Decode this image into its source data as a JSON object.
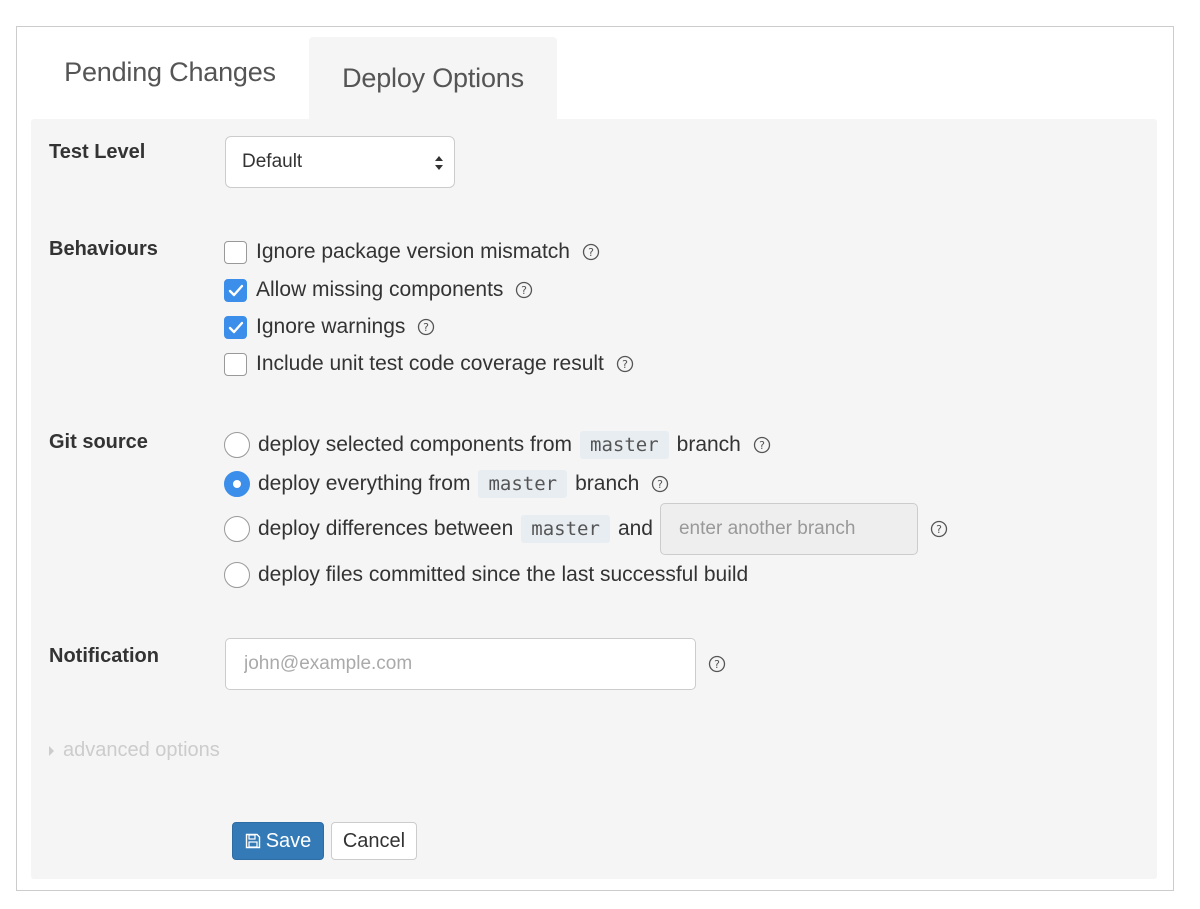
{
  "tabs": [
    {
      "label": "Pending Changes",
      "active": false
    },
    {
      "label": "Deploy Options",
      "active": true
    }
  ],
  "test_level": {
    "label": "Test Level",
    "selected": "Default"
  },
  "behaviours": {
    "label": "Behaviours",
    "options": [
      {
        "label": "Ignore package version mismatch",
        "checked": false
      },
      {
        "label": "Allow missing components",
        "checked": true
      },
      {
        "label": "Ignore warnings",
        "checked": true
      },
      {
        "label": "Include unit test code coverage result",
        "checked": false
      }
    ]
  },
  "git_source": {
    "label": "Git source",
    "selected_index": 1,
    "opt1": {
      "before": "deploy selected components from",
      "branch": "master",
      "after": "branch"
    },
    "opt2": {
      "before": "deploy everything from",
      "branch": "master",
      "after": "branch"
    },
    "opt3": {
      "before": "deploy differences between",
      "branch": "master",
      "and": "and",
      "placeholder": "enter another branch"
    },
    "opt4": {
      "text": "deploy files committed since the last successful build"
    }
  },
  "notification": {
    "label": "Notification",
    "placeholder": "john@example.com"
  },
  "advanced_label": "advanced options",
  "actions": {
    "save_label": "Save",
    "cancel_label": "Cancel"
  },
  "colors": {
    "accent": "#3b8ee9",
    "primary_button": "#337ab7",
    "panel_bg": "#f5f5f5"
  },
  "icons": {
    "help": "question-circle-icon",
    "save": "floppy-disk-icon",
    "caret": "caret-right-icon",
    "select_arrows": "sort-arrows-icon"
  }
}
